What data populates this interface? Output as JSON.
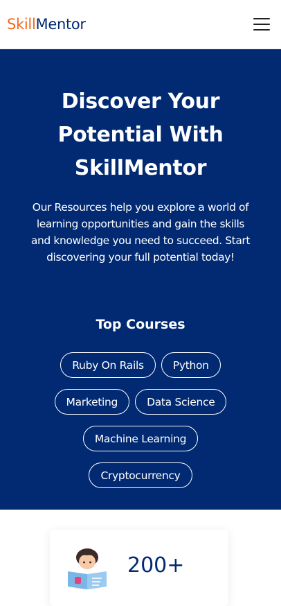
{
  "header": {
    "logo_part1": "Skill",
    "logo_part2": "Mentor",
    "menu_icon": "hamburger-icon"
  },
  "hero": {
    "title_line1": "Discover Your",
    "title_line2": "Potential With",
    "title_line3": "SkillMentor",
    "description": "Our Resources help you explore a world of learning opportunities and gain the skills and knowledge you need to succeed. Start discovering your full potential today!",
    "top_courses_title": "Top Courses",
    "courses": [
      "Ruby On Rails",
      "Python",
      "Marketing",
      "Data Science",
      "Machine Learning",
      "Cryptocurrency"
    ]
  },
  "stats": {
    "value": "200+",
    "illustration_icon": "reading-student-icon"
  },
  "colors": {
    "brand_navy": "#012a72",
    "brand_orange": "#f26a1b",
    "white": "#ffffff"
  }
}
